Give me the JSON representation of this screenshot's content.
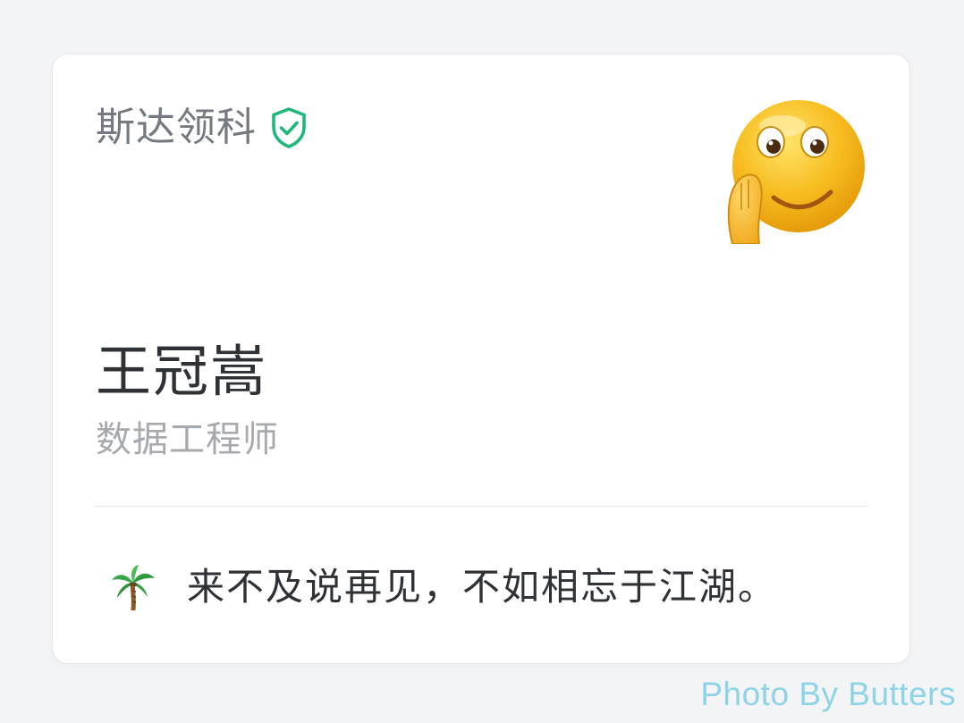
{
  "card": {
    "company": "斯达领科",
    "company_badge_icon": "verified-shield-check-icon",
    "avatar_icon": "smiling-emoji-waving-icon",
    "name": "王冠嵩",
    "job_title": "数据工程师",
    "motto_icon": "palm-tree-icon",
    "motto": "来不及说再见，不如相忘于江湖。"
  },
  "watermark": "Photo By Butters",
  "colors": {
    "background": "#f3f4f6",
    "card": "#ffffff",
    "verified_green": "#1fb87a",
    "watermark": "#8fd3e7"
  }
}
